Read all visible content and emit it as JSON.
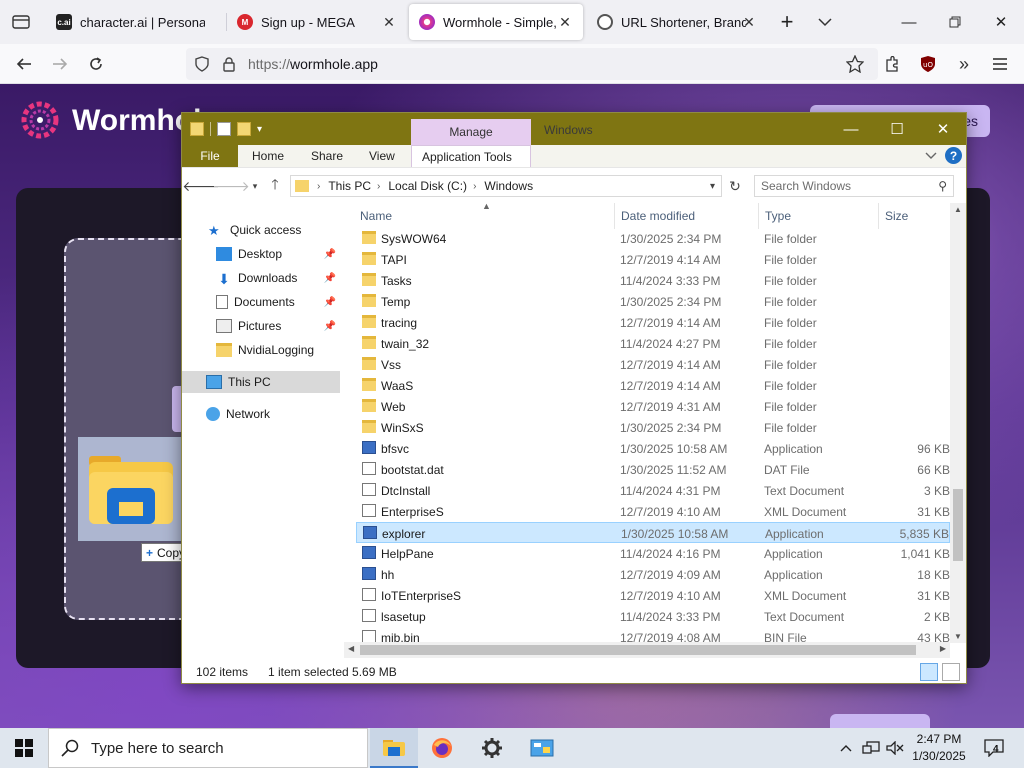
{
  "browser": {
    "tabs": [
      {
        "title": "character.ai | Personaliz",
        "favicon": "c.ai"
      },
      {
        "title": "Sign up - MEGA",
        "favicon": "M"
      },
      {
        "title": "Wormhole - Simple, pri",
        "favicon": "wormhole"
      },
      {
        "title": "URL Shortener, Brandec",
        "favicon": "link"
      }
    ],
    "url_protocol": "https://",
    "url_host": "wormhole.app"
  },
  "page": {
    "brand": "Wormhole",
    "top_button_fragment": "es",
    "copy_tooltip": "Copy"
  },
  "explorer": {
    "qat_dropdown": "▾",
    "manage_tab": "Manage",
    "window_title": "Windows",
    "ribbon_tabs": {
      "file": "File",
      "home": "Home",
      "share": "Share",
      "view": "View",
      "app_tools": "Application Tools"
    },
    "breadcrumb": [
      "This PC",
      "Local Disk (C:)",
      "Windows"
    ],
    "search_placeholder": "Search Windows",
    "nav": {
      "quick_access": "Quick access",
      "desktop": "Desktop",
      "downloads": "Downloads",
      "documents": "Documents",
      "pictures": "Pictures",
      "nvidia": "NvidiaLogging",
      "this_pc": "This PC",
      "network": "Network"
    },
    "columns": {
      "name": "Name",
      "date": "Date modified",
      "type": "Type",
      "size": "Size"
    },
    "files": [
      {
        "name": "SysWOW64",
        "date": "1/30/2025 2:34 PM",
        "type": "File folder",
        "size": "",
        "icon": "folder"
      },
      {
        "name": "TAPI",
        "date": "12/7/2019 4:14 AM",
        "type": "File folder",
        "size": "",
        "icon": "folder"
      },
      {
        "name": "Tasks",
        "date": "11/4/2024 3:33 PM",
        "type": "File folder",
        "size": "",
        "icon": "folder"
      },
      {
        "name": "Temp",
        "date": "1/30/2025 2:34 PM",
        "type": "File folder",
        "size": "",
        "icon": "folder"
      },
      {
        "name": "tracing",
        "date": "12/7/2019 4:14 AM",
        "type": "File folder",
        "size": "",
        "icon": "folder"
      },
      {
        "name": "twain_32",
        "date": "11/4/2024 4:27 PM",
        "type": "File folder",
        "size": "",
        "icon": "folder"
      },
      {
        "name": "Vss",
        "date": "12/7/2019 4:14 AM",
        "type": "File folder",
        "size": "",
        "icon": "folder"
      },
      {
        "name": "WaaS",
        "date": "12/7/2019 4:14 AM",
        "type": "File folder",
        "size": "",
        "icon": "folder"
      },
      {
        "name": "Web",
        "date": "12/7/2019 4:31 AM",
        "type": "File folder",
        "size": "",
        "icon": "folder"
      },
      {
        "name": "WinSxS",
        "date": "1/30/2025 2:34 PM",
        "type": "File folder",
        "size": "",
        "icon": "folder"
      },
      {
        "name": "bfsvc",
        "date": "1/30/2025 10:58 AM",
        "type": "Application",
        "size": "96 KB",
        "icon": "app"
      },
      {
        "name": "bootstat.dat",
        "date": "1/30/2025 11:52 AM",
        "type": "DAT File",
        "size": "66 KB",
        "icon": "doc"
      },
      {
        "name": "DtcInstall",
        "date": "11/4/2024 4:31 PM",
        "type": "Text Document",
        "size": "3 KB",
        "icon": "doc"
      },
      {
        "name": "EnterpriseS",
        "date": "12/7/2019 4:10 AM",
        "type": "XML Document",
        "size": "31 KB",
        "icon": "doc"
      },
      {
        "name": "explorer",
        "date": "1/30/2025 10:58 AM",
        "type": "Application",
        "size": "5,835 KB",
        "icon": "app"
      },
      {
        "name": "HelpPane",
        "date": "11/4/2024 4:16 PM",
        "type": "Application",
        "size": "1,041 KB",
        "icon": "app"
      },
      {
        "name": "hh",
        "date": "12/7/2019 4:09 AM",
        "type": "Application",
        "size": "18 KB",
        "icon": "app"
      },
      {
        "name": "IoTEnterpriseS",
        "date": "12/7/2019 4:10 AM",
        "type": "XML Document",
        "size": "31 KB",
        "icon": "doc"
      },
      {
        "name": "lsasetup",
        "date": "11/4/2024 3:33 PM",
        "type": "Text Document",
        "size": "2 KB",
        "icon": "doc"
      },
      {
        "name": "mib.bin",
        "date": "12/7/2019 4:08 AM",
        "type": "BIN File",
        "size": "43 KB",
        "icon": "doc"
      }
    ],
    "selected_file": "explorer",
    "status": {
      "items": "102 items",
      "selection": "1 item selected  5.69 MB"
    }
  },
  "taskbar": {
    "search_placeholder": "Type here to search",
    "time": "2:47 PM",
    "date": "1/30/2025",
    "notifications": "4"
  },
  "colors": {
    "explorer_title": "#7f7512",
    "manage_tab": "#e6cdf0",
    "selection": "#cce8ff",
    "wormhole_accent": "#c9b6f2"
  }
}
